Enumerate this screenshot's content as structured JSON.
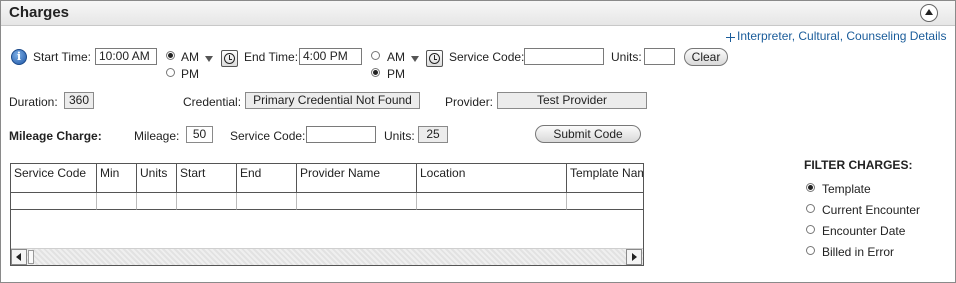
{
  "panel": {
    "title": "Charges"
  },
  "details_link": "Interpreter, Cultural, Counseling Details",
  "time_row": {
    "start_label": "Start Time:",
    "start_value": "10:00 AM",
    "start_am": "AM",
    "start_pm": "PM",
    "start_selected": "AM",
    "end_label": "End Time:",
    "end_value": "4:00 PM",
    "end_am": "AM",
    "end_pm": "PM",
    "end_selected": "PM",
    "service_code_label": "Service Code:",
    "service_code_value": "",
    "units_label": "Units:",
    "units_value": "",
    "clear_label": "Clear"
  },
  "info_row": {
    "duration_label": "Duration:",
    "duration_value": "360",
    "credential_label": "Credential:",
    "credential_value": "Primary Credential Not Found",
    "provider_label": "Provider:",
    "provider_value": "Test Provider"
  },
  "mileage_row": {
    "section_label": "Mileage Charge:",
    "mileage_label": "Mileage:",
    "mileage_value": "50",
    "service_code_label": "Service Code:",
    "service_code_value": "",
    "units_label": "Units:",
    "units_value": "25",
    "submit_label": "Submit Code"
  },
  "charges_table": {
    "columns": [
      "Service Code",
      "Min",
      "Units",
      "Start",
      "End",
      "Provider Name",
      "Location",
      "Template Name"
    ],
    "rows": []
  },
  "filter": {
    "title": "FILTER CHARGES:",
    "options": [
      "Template",
      "Current Encounter",
      "Encounter Date",
      "Billed in Error"
    ],
    "selected": "Template"
  },
  "icons": {
    "info": "info-icon",
    "clock": "clock-icon",
    "collapse": "collapse-up-icon",
    "move": "move-arrows-icon"
  },
  "colors": {
    "link": "#1a5c9a",
    "header_bg": "#e6e6e6"
  }
}
